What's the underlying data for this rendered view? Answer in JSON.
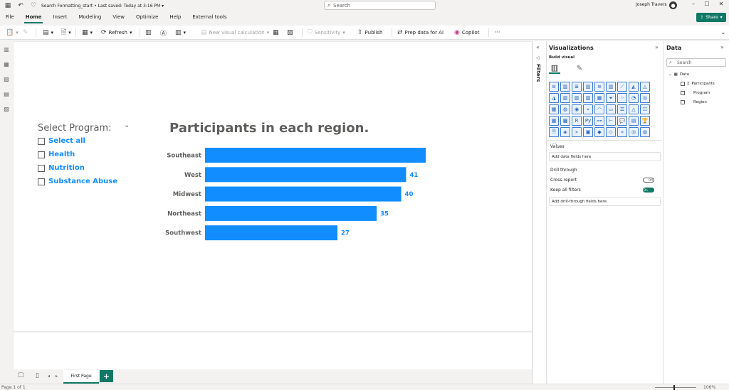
{
  "titlebar": {
    "filename": "Search Formatting_start",
    "saved": "Last saved: Today at 3:16 PM",
    "search_placeholder": "Search",
    "user": "Joseph Travers"
  },
  "menu": [
    "File",
    "Home",
    "Insert",
    "Modeling",
    "View",
    "Optimize",
    "Help",
    "External tools"
  ],
  "share_label": "Share",
  "ribbon": {
    "refresh": "Refresh",
    "new_visual_calc": "New visual calculation",
    "sensitivity": "Sensitivity",
    "publish": "Publish",
    "prep_data": "Prep data for AI",
    "copilot": "Copilot"
  },
  "slicer": {
    "title": "Select Program:",
    "items": [
      "Select all",
      "Health",
      "Nutrition",
      "Substance Abuse"
    ]
  },
  "chart_data": {
    "type": "bar",
    "orientation": "horizontal",
    "title": "Participants in each region.",
    "categories": [
      "Southeast",
      "West",
      "Midwest",
      "Northeast",
      "Southwest"
    ],
    "values": [
      45,
      41,
      40,
      35,
      27
    ],
    "data_labels": [
      "",
      "41",
      "40",
      "35",
      "27"
    ],
    "xlim": [
      0,
      45
    ],
    "grid": false,
    "bar_color": "#118dff"
  },
  "pages": {
    "tab": "First Page",
    "add": "+"
  },
  "status": {
    "page": "Page 1 of 1",
    "zoom": "106%"
  },
  "filters_label": "Filters",
  "viz_pane": {
    "title": "Visualizations",
    "build_visual": "Build visual",
    "values_label": "Values",
    "values_placeholder": "Add data fields here",
    "drill_through": "Drill through",
    "cross_report": "Cross-report",
    "cross_report_state": "Off",
    "keep_filters": "Keep all filters",
    "keep_filters_state": "On",
    "drill_placeholder": "Add drill-through fields here",
    "more": "···"
  },
  "data_pane": {
    "title": "Data",
    "search_placeholder": "Search",
    "table": "Data",
    "fields": [
      "Participants",
      "Program",
      "Region"
    ],
    "sigma": "Σ"
  },
  "colors": {
    "accent": "#117865",
    "bar": "#118dff",
    "text_muted": "#605e5c"
  }
}
